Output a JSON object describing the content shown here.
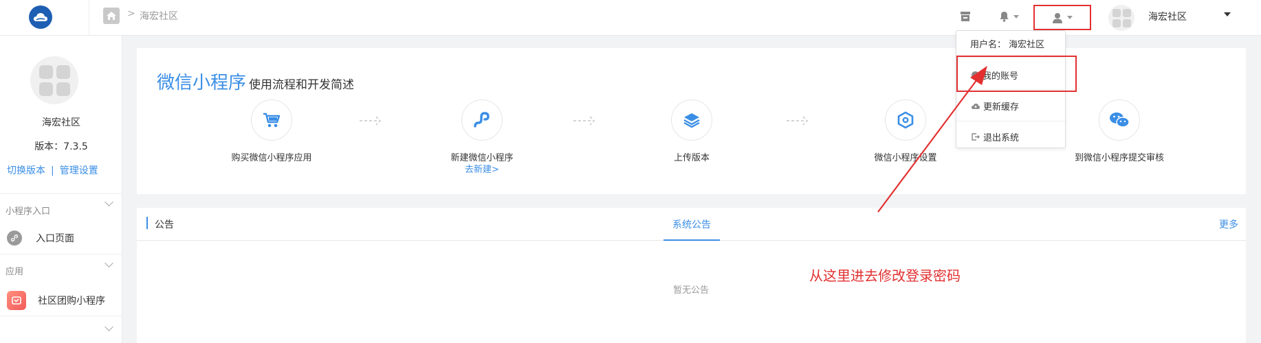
{
  "topbar": {
    "breadcrumb": "海宏社区",
    "breadcrumb_sep": ">",
    "user_name": "海宏社区"
  },
  "sidebar": {
    "name": "海宏社区",
    "version": "版本：7.3.5",
    "switch_version": "切换版本",
    "link_sep": "|",
    "manage_settings": "管理设置",
    "sections": [
      {
        "title": "小程序入口",
        "item": "入口页面"
      },
      {
        "title": "应用",
        "item": "社区团购小程序"
      }
    ]
  },
  "intro": {
    "title": "微信小程序",
    "subtitle": "使用流程和开发简述",
    "steps": [
      {
        "label": "购买微信小程序应用",
        "icon": "cart-icon"
      },
      {
        "label": "新建微信小程序",
        "link": "去新建>",
        "icon": "miniprogram-icon"
      },
      {
        "label": "上传版本",
        "icon": "layers-icon"
      },
      {
        "label": "微信小程序设置",
        "icon": "hexagon-icon"
      },
      {
        "label": "到微信小程序提交审核",
        "icon": "wechat-icon"
      }
    ]
  },
  "notice": {
    "label": "公告",
    "tab": "系统公告",
    "more": "更多",
    "empty": "暂无公告"
  },
  "dropdown": {
    "username": "用户名： 海宏社区",
    "my_account": "我的账号",
    "refresh_cache": "更新缓存",
    "logout": "退出系统"
  },
  "annotation": {
    "note": "从这里进去修改登录密码"
  },
  "colors": {
    "accent": "#3a8ee6",
    "annotation_red": "#e23030"
  }
}
